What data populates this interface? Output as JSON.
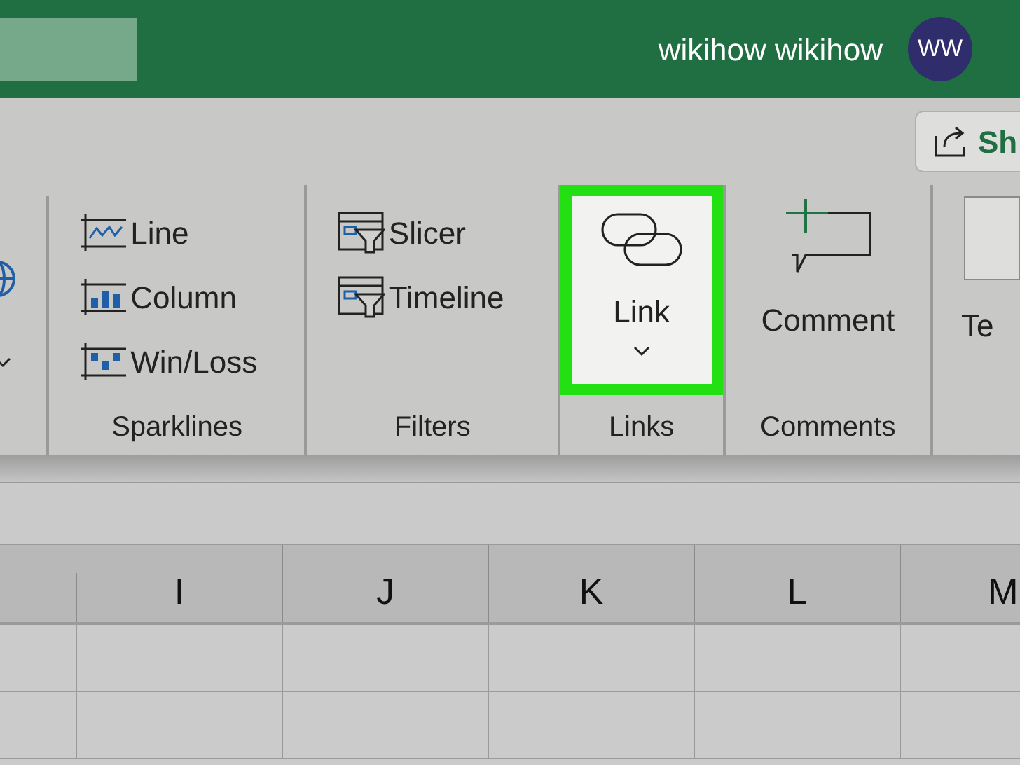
{
  "title_bar": {
    "user_name": "wikihow wikihow",
    "avatar_initials": "WW"
  },
  "share_button": {
    "label": "Sh"
  },
  "ribbon_groups": [
    {
      "kind": "small",
      "label": "Sparklines",
      "items": [
        {
          "label": "Line"
        },
        {
          "label": "Column"
        },
        {
          "label": "Win/Loss"
        }
      ]
    },
    {
      "kind": "small",
      "label": "Filters",
      "items": [
        {
          "label": "Slicer"
        },
        {
          "label": "Timeline"
        }
      ]
    },
    {
      "kind": "large",
      "label": "Links",
      "items": [
        {
          "label": "Link",
          "highlighted": true,
          "dropdown": true
        }
      ]
    },
    {
      "kind": "large",
      "label": "Comments",
      "items": [
        {
          "label": "Comment",
          "highlighted": false,
          "dropdown": false
        }
      ]
    }
  ],
  "cut_off_button": {
    "label": "Te"
  },
  "columns": [
    "I",
    "J",
    "K",
    "L",
    "M"
  ]
}
